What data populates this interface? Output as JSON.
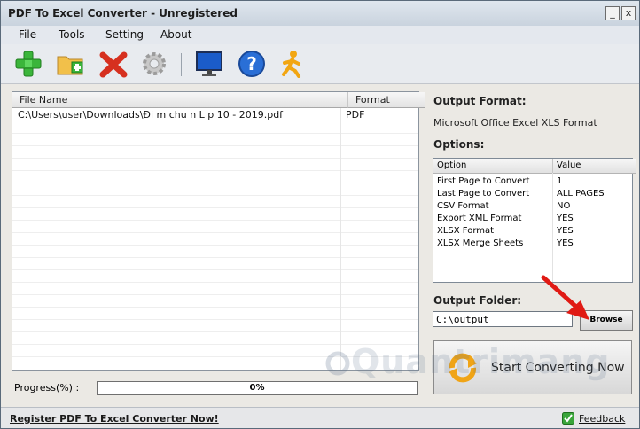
{
  "window": {
    "title": "PDF To Excel Converter - Unregistered",
    "minimize": "_",
    "close": "x"
  },
  "menu": [
    {
      "label": "File"
    },
    {
      "label": "Tools"
    },
    {
      "label": "Setting"
    },
    {
      "label": "About"
    }
  ],
  "toolbar": {
    "icons": [
      "add-file-icon",
      "add-folder-icon",
      "remove-icon",
      "settings-icon",
      "monitor-icon",
      "help-icon",
      "running-man-icon"
    ]
  },
  "file_list": {
    "columns": {
      "name": "File Name",
      "format": "Format"
    },
    "rows": [
      {
        "name": "C:\\Users\\user\\Downloads\\Đi m chu n L p 10 - 2019.pdf",
        "format": "PDF"
      }
    ]
  },
  "progress": {
    "label": "Progress(%)  :",
    "value": "0%",
    "fraction": 0
  },
  "output": {
    "format_heading": "Output Format:",
    "format_value": "Microsoft Office Excel XLS Format",
    "options_heading": "Options:"
  },
  "options": {
    "columns": {
      "option": "Option",
      "value": "Value"
    },
    "rows": [
      {
        "option": "First Page to Convert",
        "value": "1"
      },
      {
        "option": "Last Page to Convert",
        "value": "ALL PAGES"
      },
      {
        "option": "CSV Format",
        "value": "NO"
      },
      {
        "option": "Export XML Format",
        "value": "YES"
      },
      {
        "option": "XLSX Format",
        "value": "YES"
      },
      {
        "option": "XLSX Merge Sheets",
        "value": "YES"
      }
    ]
  },
  "folder": {
    "heading": "Output Folder:",
    "value": "C:\\output",
    "browse_label": "Browse"
  },
  "start_button": {
    "label": "Start Converting Now"
  },
  "status": {
    "register": "Register PDF To Excel Converter Now!",
    "feedback": "Feedback"
  },
  "watermark": "Quantrimang",
  "colors": {
    "accent": "#2a6fd6",
    "arrow": "#e01a14",
    "title_bar": "#d3dbe5"
  }
}
